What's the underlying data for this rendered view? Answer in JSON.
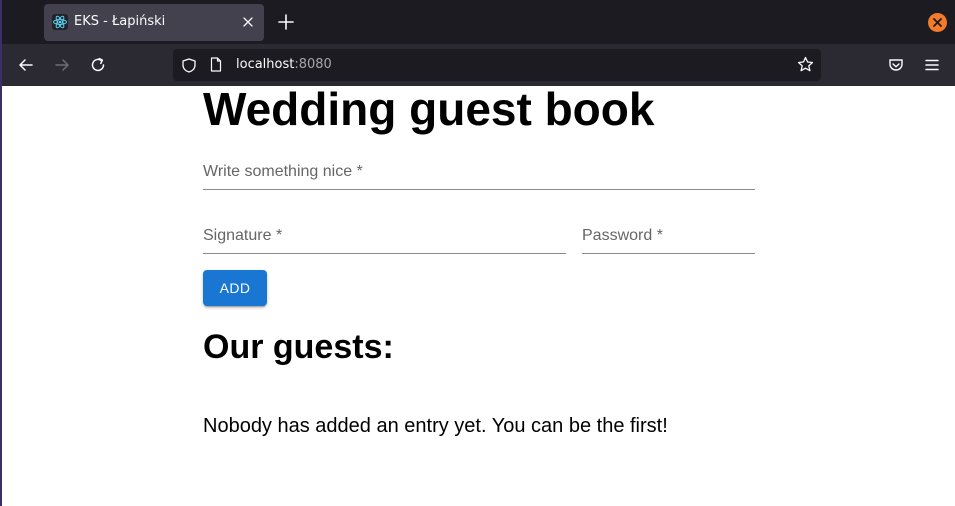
{
  "browser": {
    "tab": {
      "title": "EKS - Łapiński"
    },
    "address": {
      "host": "localhost",
      "port": ":8080"
    },
    "icons": {
      "favicon": "react-logo-icon",
      "close_tab": "close-icon",
      "new_tab": "plus-icon",
      "close_window": "window-close-icon",
      "back": "arrow-left-icon",
      "forward": "arrow-right-icon",
      "reload": "reload-icon",
      "shield": "shield-icon",
      "page": "page-icon",
      "bookmark": "star-icon",
      "pocket": "pocket-icon",
      "menu": "hamburger-menu-icon"
    }
  },
  "page": {
    "title": "Wedding guest book",
    "form": {
      "message_label": "Write something nice *",
      "signature_label": "Signature *",
      "password_label": "Password *",
      "add_label": "ADD"
    },
    "guests_heading": "Our guests:",
    "empty_message": "Nobody has added an entry yet. You can be the first!"
  },
  "colors": {
    "accent": "#1976d2",
    "window_close": "#f37b2a",
    "chrome_dark": "#1c1b22",
    "tab_active": "#42414d",
    "toolbar": "#2b2a33"
  }
}
